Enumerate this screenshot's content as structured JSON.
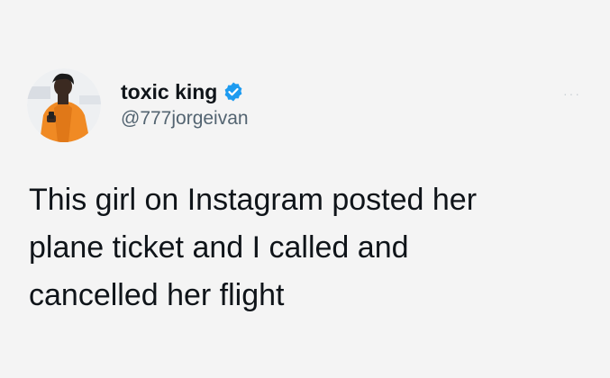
{
  "tweet": {
    "display_name": "toxic king",
    "handle": "@777jorgeivan",
    "text": "This girl on Instagram posted her\nplane ticket and I called and\ncancelled her flight",
    "more_label": "···"
  },
  "icons": {
    "verified": "verified-badge-icon",
    "more": "more-options-icon"
  },
  "colors": {
    "background": "#f4f4f4",
    "text": "#0f1419",
    "handle": "#536471",
    "verified": "#1d9bf0"
  }
}
